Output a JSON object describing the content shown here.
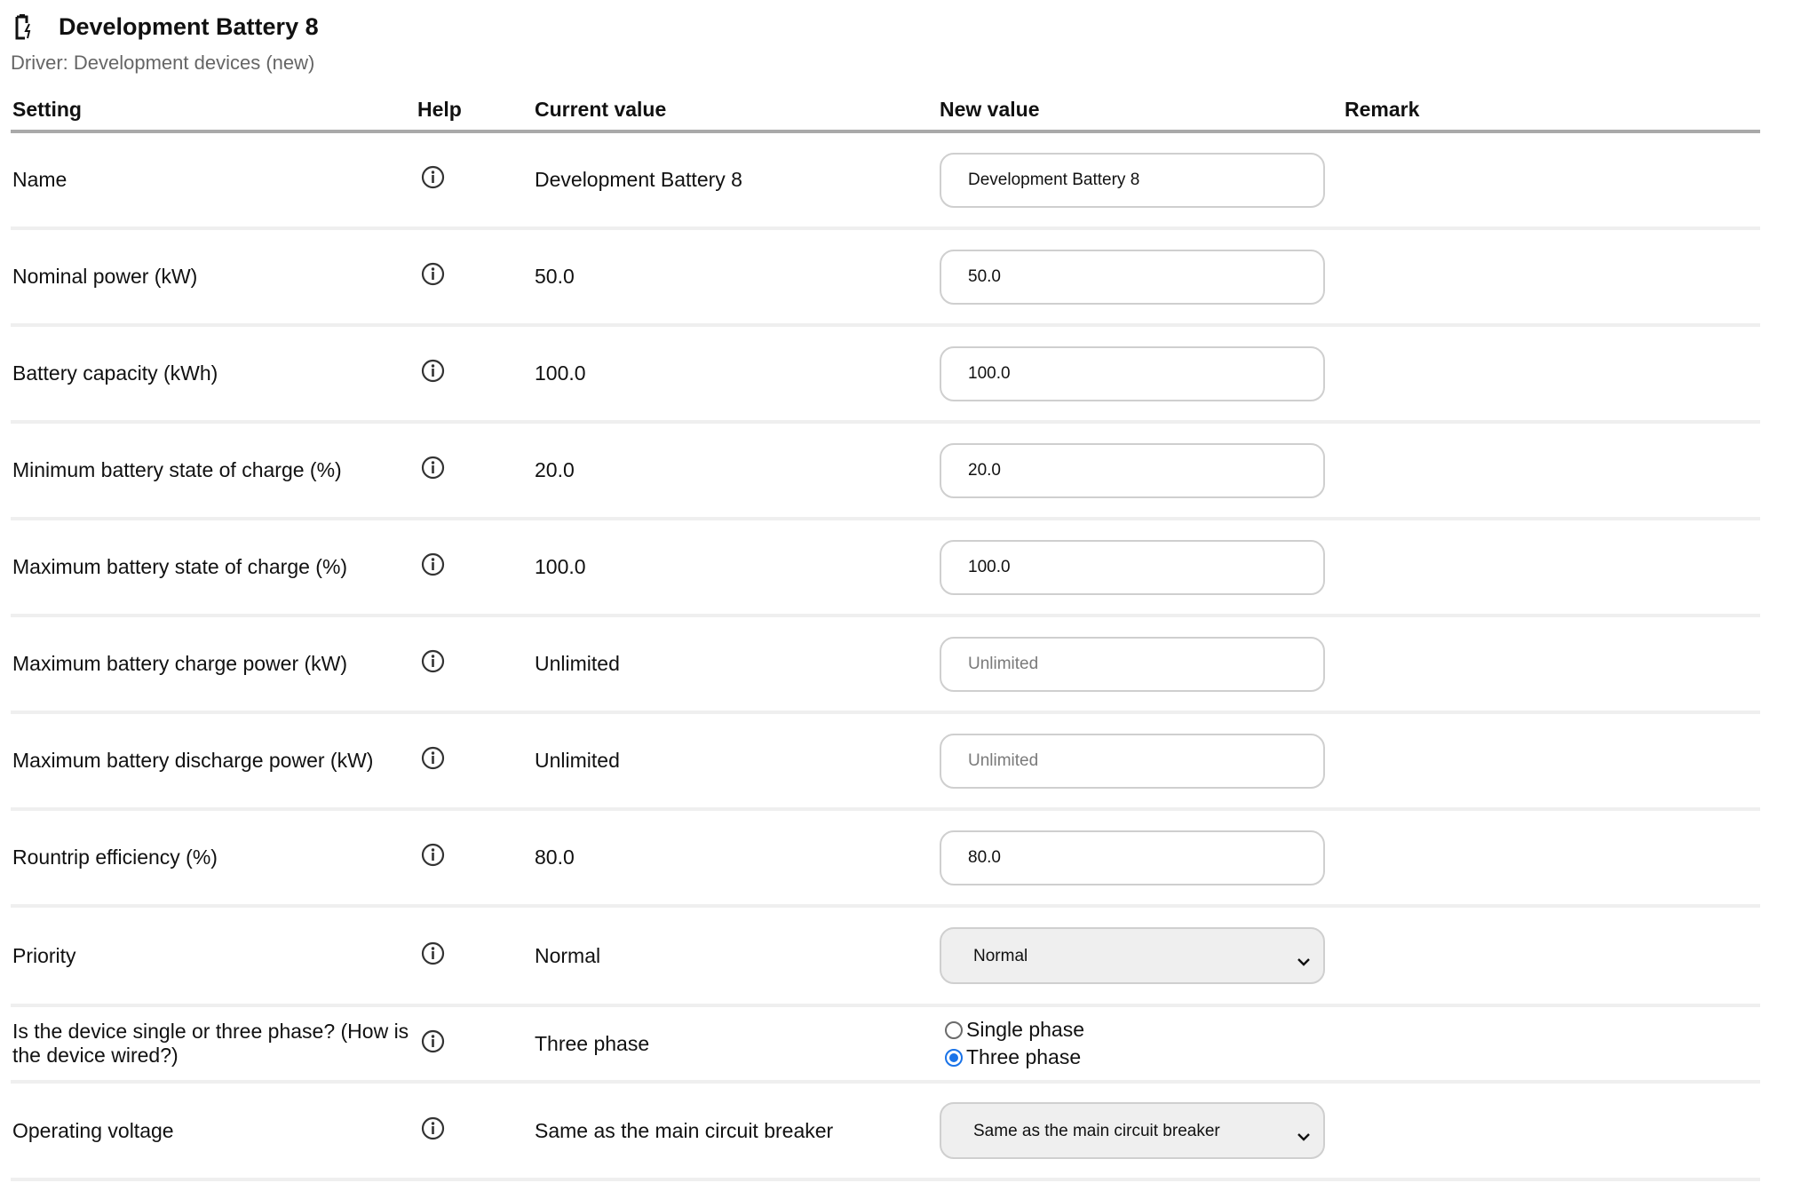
{
  "header": {
    "icon": "battery-charging-icon",
    "title": "Development Battery 8",
    "driver": "Driver: Development devices (new)"
  },
  "table": {
    "columns": {
      "setting": "Setting",
      "help": "Help",
      "current": "Current value",
      "new": "New value",
      "remark": "Remark"
    },
    "rows": [
      {
        "setting": "Name",
        "current": "Development Battery 8",
        "input_value": "Development Battery 8",
        "input_placeholder": ""
      },
      {
        "setting": "Nominal power (kW)",
        "current": "50.0",
        "input_value": "50.0",
        "input_placeholder": ""
      },
      {
        "setting": "Battery capacity (kWh)",
        "current": "100.0",
        "input_value": "100.0",
        "input_placeholder": ""
      },
      {
        "setting": "Minimum battery state of charge (%)",
        "current": "20.0",
        "input_value": "20.0",
        "input_placeholder": ""
      },
      {
        "setting": "Maximum battery state of charge (%)",
        "current": "100.0",
        "input_value": "100.0",
        "input_placeholder": ""
      },
      {
        "setting": "Maximum battery charge power (kW)",
        "current": "Unlimited",
        "input_value": "",
        "input_placeholder": "Unlimited"
      },
      {
        "setting": "Maximum battery discharge power (kW)",
        "current": "Unlimited",
        "input_value": "",
        "input_placeholder": "Unlimited"
      },
      {
        "setting": "Rountrip efficiency (%)",
        "current": "80.0",
        "input_value": "80.0",
        "input_placeholder": ""
      },
      {
        "setting": "Priority",
        "current": "Normal",
        "select_value": "Normal"
      },
      {
        "setting": "Is the device single or three phase? (How is the device wired?)",
        "current": "Three phase",
        "radio_options": [
          "Single phase",
          "Three phase"
        ],
        "radio_selected": "Three phase"
      },
      {
        "setting": "Operating voltage",
        "current": "Same as the main circuit breaker",
        "select_value": "Same as the main circuit breaker"
      }
    ]
  },
  "colors": {
    "header_rule": "#a9a9a9",
    "row_rule": "#efefef",
    "radio_accent": "#1a73e8",
    "select_bg": "#efefef"
  }
}
